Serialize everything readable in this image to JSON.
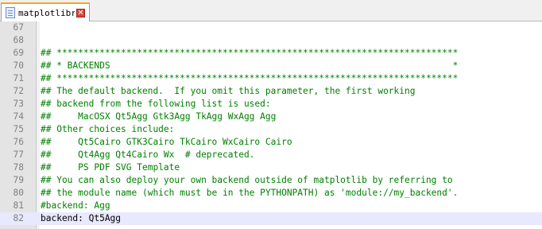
{
  "tab": {
    "filename": "matplotlibrc",
    "close_glyph": "✕"
  },
  "colors": {
    "comment": "#008000",
    "text": "#000000",
    "line_number": "#808080",
    "current_line_bg": "#e8e8ff",
    "tab_accent": "#f5a623"
  },
  "lines": [
    {
      "num": "67",
      "text": "",
      "kind": "plain"
    },
    {
      "num": "68",
      "text": "",
      "kind": "plain"
    },
    {
      "num": "69",
      "text": "## ***************************************************************************",
      "kind": "comment"
    },
    {
      "num": "70",
      "text": "## * BACKENDS                                                                *",
      "kind": "comment"
    },
    {
      "num": "71",
      "text": "## ***************************************************************************",
      "kind": "comment"
    },
    {
      "num": "72",
      "text": "## The default backend.  If you omit this parameter, the first working",
      "kind": "comment"
    },
    {
      "num": "73",
      "text": "## backend from the following list is used:",
      "kind": "comment"
    },
    {
      "num": "74",
      "text": "##     MacOSX Qt5Agg Gtk3Agg TkAgg WxAgg Agg",
      "kind": "comment"
    },
    {
      "num": "75",
      "text": "## Other choices include:",
      "kind": "comment"
    },
    {
      "num": "76",
      "text": "##     Qt5Cairo GTK3Cairo TkCairo WxCairo Cairo",
      "kind": "comment"
    },
    {
      "num": "77",
      "text": "##     Qt4Agg Qt4Cairo Wx  # deprecated.",
      "kind": "comment"
    },
    {
      "num": "78",
      "text": "##     PS PDF SVG Template",
      "kind": "comment"
    },
    {
      "num": "79",
      "text": "## You can also deploy your own backend outside of matplotlib by referring to",
      "kind": "comment"
    },
    {
      "num": "80",
      "text": "## the module name (which must be in the PYTHONPATH) as 'module://my_backend'.",
      "kind": "comment"
    },
    {
      "num": "81",
      "text": "#backend: Agg",
      "kind": "comment"
    },
    {
      "num": "82",
      "text": "backend: Qt5Agg",
      "kind": "plain",
      "current": true
    }
  ]
}
